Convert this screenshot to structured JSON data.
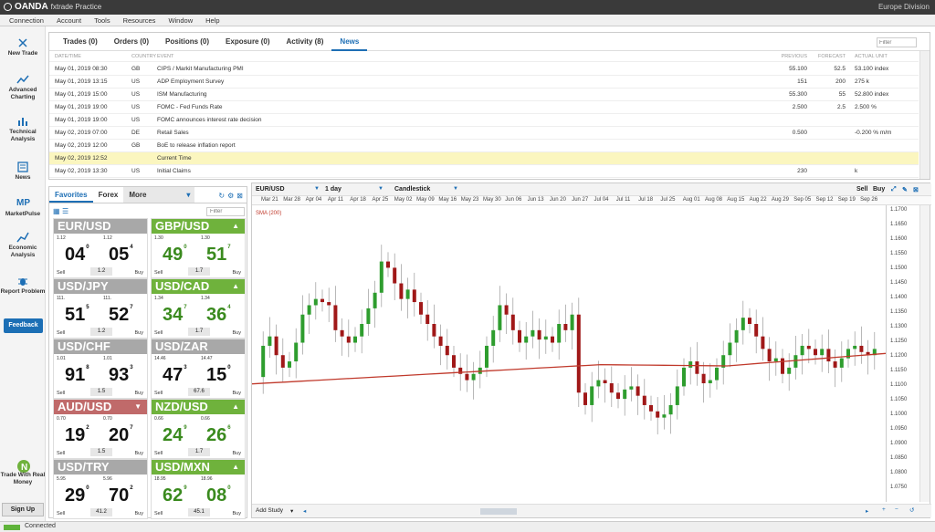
{
  "app": {
    "logo": "OANDA",
    "product": "fxtrade Practice",
    "region": "Europe Division"
  },
  "menu": [
    "Connection",
    "Account",
    "Tools",
    "Resources",
    "Window",
    "Help"
  ],
  "sidebar": {
    "items": [
      {
        "label": "New Trade",
        "icon": "plus-icon"
      },
      {
        "label": "Advanced Charting",
        "icon": "chart-icon"
      },
      {
        "label": "Technical Analysis",
        "icon": "bar-chart-icon"
      },
      {
        "label": "News",
        "icon": "news-icon"
      },
      {
        "label": "MarketPulse",
        "icon": "mp-logo-icon"
      },
      {
        "label": "Economic Analysis",
        "icon": "line-chart-icon"
      },
      {
        "label": "Report Problem",
        "icon": "bug-icon"
      }
    ],
    "feedback": "Feedback",
    "trade_real": "Trade With Real Money",
    "signup": "Sign Up"
  },
  "status": {
    "text": "Connected"
  },
  "news_panel": {
    "tabs": [
      "Trades (0)",
      "Orders (0)",
      "Positions (0)",
      "Exposure (0)",
      "Activity (8)",
      "News"
    ],
    "active_tab": 5,
    "filter_placeholder": "Filter",
    "headers": {
      "date": "DATE/TIME",
      "country": "COUNTRY",
      "event": "EVENT",
      "previous": "PREVIOUS",
      "forecast": "FORECAST",
      "actual": "ACTUAL UNIT"
    },
    "rows": [
      {
        "date": "May 01, 2019  08:30",
        "country": "GB",
        "event": "CIPS / Markit Manufacturing PMI",
        "previous": "55.100",
        "forecast": "52.5",
        "actual": "53.100 index"
      },
      {
        "date": "May 01, 2019  13:15",
        "country": "US",
        "event": "ADP Employment Survey",
        "previous": "151",
        "forecast": "200",
        "actual": "275 k"
      },
      {
        "date": "May 01, 2019  15:00",
        "country": "US",
        "event": "ISM Manufacturing",
        "previous": "55.300",
        "forecast": "55",
        "actual": "52.800 index"
      },
      {
        "date": "May 01, 2019  19:00",
        "country": "US",
        "event": "FOMC - Fed Funds Rate",
        "previous": "2.500",
        "forecast": "2.5",
        "actual": "2.500 %"
      },
      {
        "date": "May 01, 2019  19:00",
        "country": "US",
        "event": "FOMC announces interest rate decision",
        "previous": "",
        "forecast": "",
        "actual": ""
      },
      {
        "date": "May 02, 2019  07:00",
        "country": "DE",
        "event": "Retail Sales",
        "previous": "0.500",
        "forecast": "",
        "actual": "-0.200 % m/m"
      },
      {
        "date": "May 02, 2019  12:00",
        "country": "GB",
        "event": "BoE to release inflation report",
        "previous": "",
        "forecast": "",
        "actual": ""
      },
      {
        "date": "May 02, 2019  12:52",
        "country": "",
        "event": "Current Time",
        "previous": "",
        "forecast": "",
        "actual": ""
      },
      {
        "date": "May 02, 2019  13:30",
        "country": "US",
        "event": "Initial Claims",
        "previous": "230",
        "forecast": "",
        "actual": "k"
      }
    ]
  },
  "watchlist": {
    "tabs": [
      "Favorites",
      "Forex",
      "More"
    ],
    "filter_placeholder": "Filter",
    "sell": "Sell",
    "buy": "Buy",
    "tiles": [
      {
        "pair": "EUR/USD",
        "dir": "none",
        "sell_small": "1.12",
        "buy_small": "1.12",
        "sell_big": "04",
        "sell_sup": "0",
        "buy_big": "05",
        "buy_sup": "4",
        "spread": "1.2"
      },
      {
        "pair": "GBP/USD",
        "dir": "up",
        "sell_small": "1.30",
        "buy_small": "1.30",
        "sell_big": "49",
        "sell_sup": "0",
        "buy_big": "51",
        "buy_sup": "7",
        "spread": "1.7"
      },
      {
        "pair": "USD/JPY",
        "dir": "none",
        "sell_small": "111.",
        "buy_small": "111.",
        "sell_big": "51",
        "sell_sup": "5",
        "buy_big": "52",
        "buy_sup": "7",
        "spread": "1.2"
      },
      {
        "pair": "USD/CAD",
        "dir": "up",
        "sell_small": "1.34",
        "buy_small": "1.34",
        "sell_big": "34",
        "sell_sup": "7",
        "buy_big": "36",
        "buy_sup": "4",
        "spread": "1.7"
      },
      {
        "pair": "USD/CHF",
        "dir": "none",
        "sell_small": "1.01",
        "buy_small": "1.01",
        "sell_big": "91",
        "sell_sup": "8",
        "buy_big": "93",
        "buy_sup": "3",
        "spread": "1.5"
      },
      {
        "pair": "USD/ZAR",
        "dir": "none",
        "sell_small": "14.46",
        "buy_small": "14.47",
        "sell_big": "47",
        "sell_sup": "3",
        "buy_big": "15",
        "buy_sup": "0",
        "spread": "67.6"
      },
      {
        "pair": "AUD/USD",
        "dir": "down",
        "sell_small": "0.70",
        "buy_small": "0.70",
        "sell_big": "19",
        "sell_sup": "2",
        "buy_big": "20",
        "buy_sup": "7",
        "spread": "1.5"
      },
      {
        "pair": "NZD/USD",
        "dir": "up",
        "sell_small": "0.66",
        "buy_small": "0.66",
        "sell_big": "24",
        "sell_sup": "9",
        "buy_big": "26",
        "buy_sup": "6",
        "spread": "1.7"
      },
      {
        "pair": "USD/TRY",
        "dir": "none",
        "sell_small": "5.95",
        "buy_small": "5.96",
        "sell_big": "29",
        "sell_sup": "0",
        "buy_big": "70",
        "buy_sup": "2",
        "spread": "41.2"
      },
      {
        "pair": "USD/MXN",
        "dir": "up",
        "sell_small": "18.95",
        "buy_small": "18.96",
        "sell_big": "62",
        "sell_sup": "9",
        "buy_big": "08",
        "buy_sup": "0",
        "spread": "45.1"
      }
    ]
  },
  "chart": {
    "instrument": "EUR/USD",
    "timeframe": "1 day",
    "style": "Candlestick",
    "sell": "Sell",
    "buy": "Buy",
    "add_study": "Add Study",
    "sma_label": "SMA (200)",
    "dates": [
      "Mar 21",
      "Mar 28",
      "Apr 04",
      "Apr 11",
      "Apr 18",
      "Apr 25",
      "May 02",
      "May 09",
      "May 16",
      "May 23",
      "May 30",
      "Jun 06",
      "Jun 13",
      "Jun 20",
      "Jun 27",
      "Jul 04",
      "Jul 11",
      "Jul 18",
      "Jul 25",
      "Aug 01",
      "Aug 08",
      "Aug 15",
      "Aug 22",
      "Aug 29",
      "Sep 05",
      "Sep 12",
      "Sep 19",
      "Sep 26"
    ],
    "y_ticks": [
      "1.1700",
      "1.1650",
      "1.1600",
      "1.1550",
      "1.1500",
      "1.1450",
      "1.1400",
      "1.1350",
      "1.1300",
      "1.1250",
      "1.1200",
      "1.1150",
      "1.1100",
      "1.1050",
      "1.1000",
      "1.0950",
      "1.0900",
      "1.0850",
      "1.0800",
      "1.0750"
    ],
    "colors": {
      "up": "#2e9d2e",
      "down": "#a01818",
      "sma": "#c0392b"
    }
  },
  "colors": {
    "accent": "#1e6fb5",
    "tile_up": "#6fb23c",
    "tile_down": "#c06a6a",
    "tile_neutral": "#a8a8a8",
    "current_row": "#fbf6bf"
  }
}
